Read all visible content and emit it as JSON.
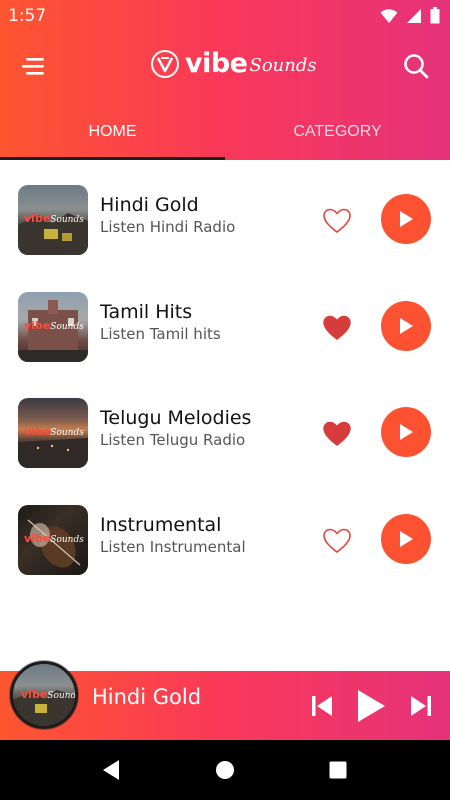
{
  "status": {
    "time": "1:57"
  },
  "header": {
    "logo_main": "vibe",
    "logo_script": "Sounds",
    "tabs": [
      {
        "label": "HOME",
        "active": true
      },
      {
        "label": "CATEGORY",
        "active": false
      }
    ]
  },
  "stations": [
    {
      "title": "Hindi Gold",
      "subtitle": "Listen Hindi Radio",
      "favorite": false,
      "thumb": "street-scene"
    },
    {
      "title": "Tamil Hits",
      "subtitle": "Listen Tamil hits",
      "favorite": true,
      "thumb": "temple"
    },
    {
      "title": "Telugu Melodies",
      "subtitle": "Listen Telugu Radio",
      "favorite": true,
      "thumb": "sunset-city"
    },
    {
      "title": "Instrumental",
      "subtitle": "Listen Instrumental",
      "favorite": false,
      "thumb": "violin"
    }
  ],
  "thumb_mark": {
    "vibe": "vibe",
    "sounds": "Sounds"
  },
  "player": {
    "now_playing": "Hindi Gold"
  },
  "colors": {
    "accent": "#fd5232",
    "gradient_start": "#fd5530",
    "gradient_end": "#e5327a",
    "heart": "#e0453e"
  },
  "icons": {
    "menu": "menu-icon",
    "search": "search-icon",
    "heart_outline": "heart-outline-icon",
    "heart_filled": "heart-filled-icon",
    "play": "play-icon",
    "previous": "skip-previous-icon",
    "next": "skip-next-icon",
    "back": "nav-back-icon",
    "home": "nav-home-icon",
    "recents": "nav-recents-icon"
  }
}
